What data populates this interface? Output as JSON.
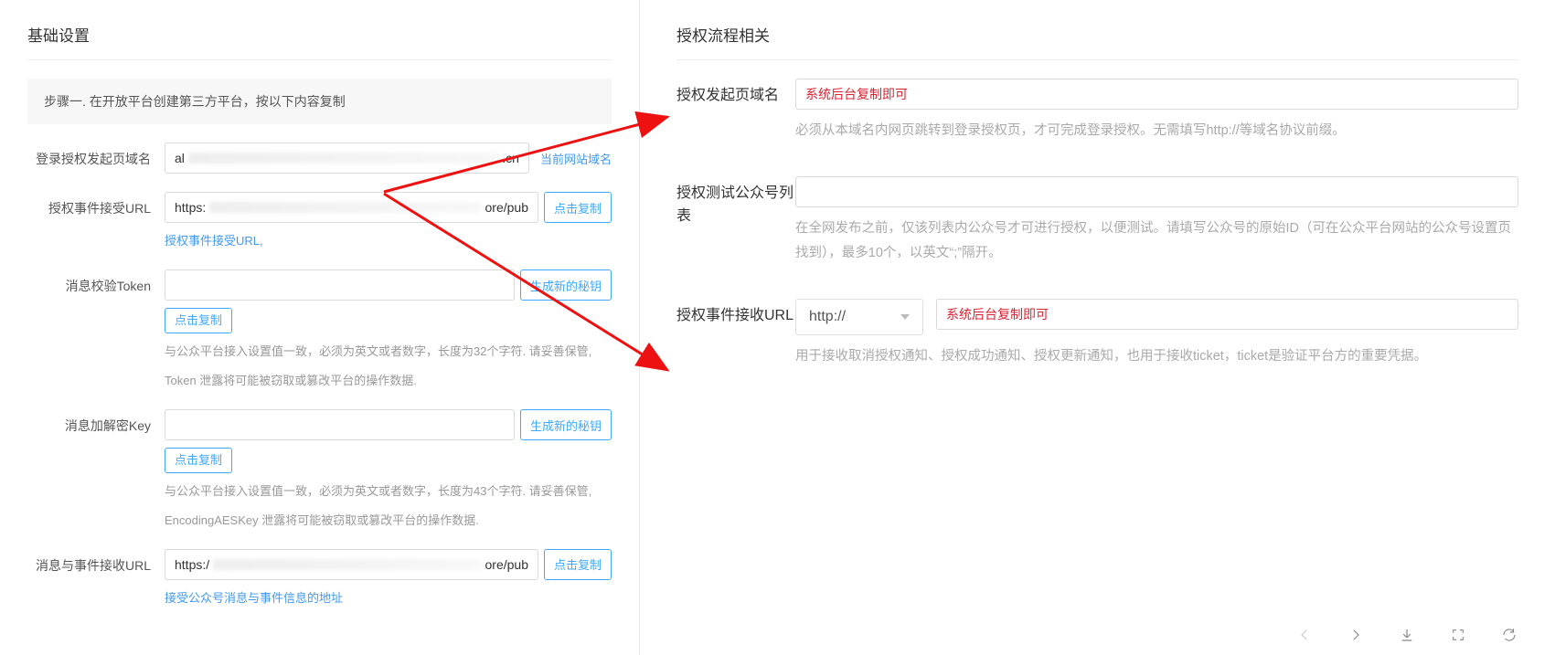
{
  "left": {
    "title": "基础设置",
    "step_header": "步骤一. 在开放平台创建第三方平台，按以下内容复制",
    "current_domain_link": "当前网站域名",
    "fields": {
      "login_domain": {
        "label": "登录授权发起页域名",
        "value_prefix": "al",
        "value_suffix": ".cn"
      },
      "event_url": {
        "label": "授权事件接受URL",
        "value_prefix": "https:",
        "value_suffix": "ore/pub",
        "copy_btn": "点击复制",
        "helper": "授权事件接受URL,"
      },
      "token": {
        "label": "消息校验Token",
        "gen_btn": "生成新的秘钥",
        "copy_btn": "点击复制",
        "helper1": "与公众平台接入设置值一致，必须为英文或者数字，长度为32个字符. 请妥善保管,",
        "helper2": "Token 泄露将可能被窃取或篡改平台的操作数据."
      },
      "aeskey": {
        "label": "消息加解密Key",
        "gen_btn": "生成新的秘钥",
        "copy_btn": "点击复制",
        "helper1": "与公众平台接入设置值一致，必须为英文或者数字，长度为43个字符. 请妥善保管,",
        "helper2": "EncodingAESKey 泄露将可能被窃取或篡改平台的操作数据."
      },
      "msg_url": {
        "label": "消息与事件接收URL",
        "value_prefix": "https:/",
        "value_suffix": "ore/pub",
        "copy_btn": "点击复制",
        "helper": "接受公众号消息与事件信息的地址"
      }
    }
  },
  "right": {
    "title": "授权流程相关",
    "auth_domain": {
      "label": "授权发起页域名",
      "placeholder": "系统后台复制即可",
      "help": "必须从本域名内网页跳转到登录授权页，才可完成登录授权。无需填写http://等域名协议前缀。"
    },
    "test_accounts": {
      "label": "授权测试公众号列表",
      "help": "在全网发布之前，仅该列表内公众号才可进行授权，以便测试。请填写公众号的原始ID（可在公众平台网站的公众号设置页找到），最多10个，以英文“;”隔开。"
    },
    "auth_event_url": {
      "label": "授权事件接收URL",
      "protocol": "http://",
      "placeholder": "系统后台复制即可",
      "help": "用于接收取消授权通知、授权成功通知、授权更新通知，也用于接收ticket，ticket是验证平台方的重要凭据。"
    }
  }
}
